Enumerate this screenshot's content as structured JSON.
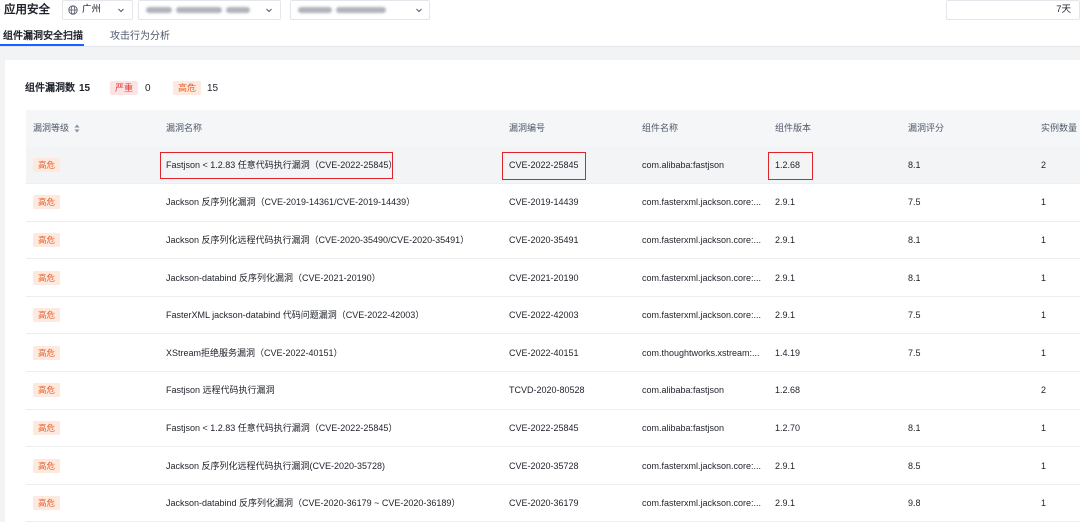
{
  "header": {
    "title": "应用安全",
    "region_label": "广州",
    "time_range": "7天"
  },
  "tabs": [
    {
      "label": "组件漏洞安全扫描",
      "active": true
    },
    {
      "label": "攻击行为分析",
      "active": false
    }
  ],
  "summary": {
    "label": "组件漏洞数",
    "total": "15",
    "severe_label": "严重",
    "severe_count": "0",
    "high_label": "高危",
    "high_count": "15"
  },
  "table": {
    "columns": [
      "漏洞等级",
      "漏洞名称",
      "漏洞编号",
      "组件名称",
      "组件版本",
      "漏洞评分",
      "实例数量"
    ],
    "rows": [
      {
        "level": "高危",
        "name": "Fastjson < 1.2.83 任意代码执行漏洞（CVE-2022-25845）",
        "cve": "CVE-2022-25845",
        "component": "com.alibaba:fastjson",
        "version": "1.2.68",
        "score": "8.1",
        "instances": "2",
        "highlighted": true
      },
      {
        "level": "高危",
        "name": "Jackson 反序列化漏洞（CVE-2019-14361/CVE-2019-14439）",
        "cve": "CVE-2019-14439",
        "component": "com.fasterxml.jackson.core:...",
        "version": "2.9.1",
        "score": "7.5",
        "instances": "1"
      },
      {
        "level": "高危",
        "name": "Jackson 反序列化远程代码执行漏洞（CVE-2020-35490/CVE-2020-35491）",
        "cve": "CVE-2020-35491",
        "component": "com.fasterxml.jackson.core:...",
        "version": "2.9.1",
        "score": "8.1",
        "instances": "1"
      },
      {
        "level": "高危",
        "name": "Jackson-databind 反序列化漏洞（CVE-2021-20190）",
        "cve": "CVE-2021-20190",
        "component": "com.fasterxml.jackson.core:...",
        "version": "2.9.1",
        "score": "8.1",
        "instances": "1"
      },
      {
        "level": "高危",
        "name": "FasterXML jackson-databind 代码问题漏洞（CVE-2022-42003）",
        "cve": "CVE-2022-42003",
        "component": "com.fasterxml.jackson.core:...",
        "version": "2.9.1",
        "score": "7.5",
        "instances": "1"
      },
      {
        "level": "高危",
        "name": "XStream拒绝服务漏洞（CVE-2022-40151）",
        "cve": "CVE-2022-40151",
        "component": "com.thoughtworks.xstream:...",
        "version": "1.4.19",
        "score": "7.5",
        "instances": "1"
      },
      {
        "level": "高危",
        "name": "Fastjson 远程代码执行漏洞",
        "cve": "TCVD-2020-80528",
        "component": "com.alibaba:fastjson",
        "version": "1.2.68",
        "instances": "2"
      },
      {
        "level": "高危",
        "name": "Fastjson < 1.2.83 任意代码执行漏洞（CVE-2022-25845）",
        "cve": "CVE-2022-25845",
        "component": "com.alibaba:fastjson",
        "version": "1.2.70",
        "score": "8.1",
        "instances": "1"
      },
      {
        "level": "高危",
        "name": "Jackson 反序列化远程代码执行漏洞(CVE-2020-35728)",
        "cve": "CVE-2020-35728",
        "component": "com.fasterxml.jackson.core:...",
        "version": "2.9.1",
        "score": "8.5",
        "instances": "1"
      },
      {
        "level": "高危",
        "name": "Jackson-databind 反序列化漏洞（CVE-2020-36179 ~ CVE-2020-36189）",
        "cve": "CVE-2020-36179",
        "component": "com.fasterxml.jackson.core:...",
        "version": "2.9.1",
        "score": "9.8",
        "instances": "1"
      }
    ]
  },
  "icons": {
    "region": "globe-icon",
    "dropdown": "chevron-down-icon",
    "sort": "sort-icon"
  },
  "colors": {
    "accent": "#1664ff",
    "text": "#1d2129",
    "muted": "#4e5969",
    "high_bg": "#fde9de",
    "high_text": "#e8602c",
    "severe_bg": "#fde4e4",
    "severe_text": "#e23a3a",
    "annotation": "#e1242b",
    "row_highlight": "#f3f4f6",
    "header_bg": "#f5f6f8"
  }
}
